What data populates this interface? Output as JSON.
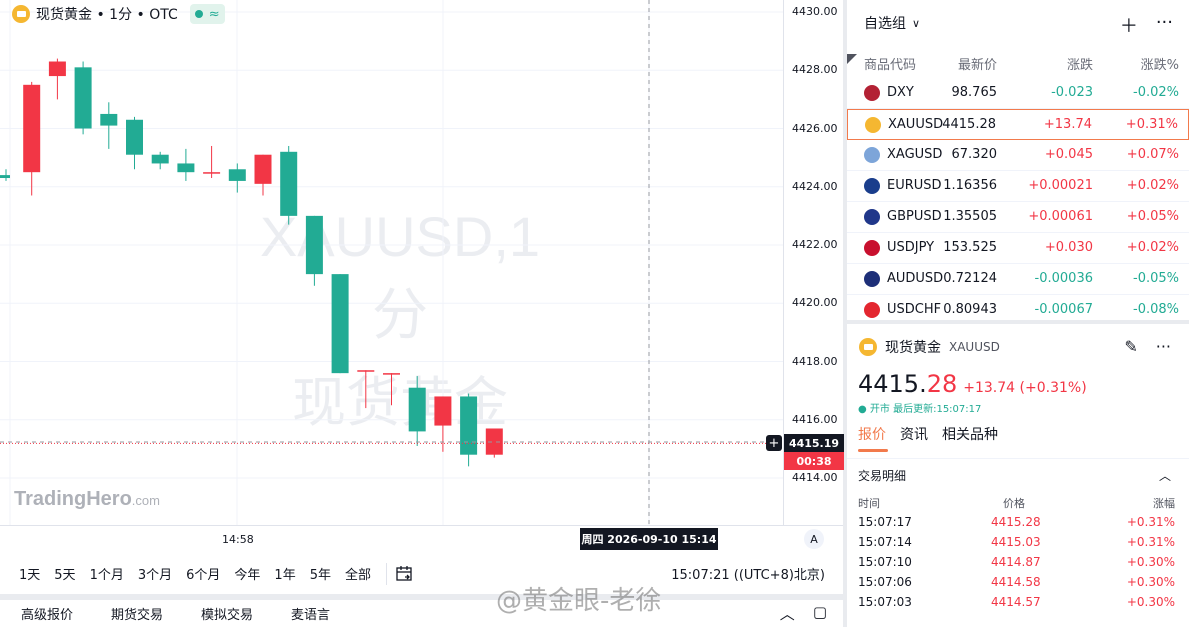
{
  "legend": {
    "title": "现货黄金 • 1分 • OTC",
    "status_icon": "≈"
  },
  "watermark": {
    "line1": "XAUUSD,1分",
    "line2": "现货黄金"
  },
  "logo": {
    "name": "TradingHero",
    "suffix": ".com"
  },
  "colors": {
    "up": "#f23645",
    "down": "#22ab94",
    "accent": "#f27a4c",
    "gold": "#f5b731"
  },
  "chart_data": {
    "type": "candlestick",
    "interval": "1分",
    "symbol": "XAUUSD",
    "y_ticks": [
      "4430.00",
      "4428.00",
      "4426.00",
      "4424.00",
      "4422.00",
      "4420.00",
      "4418.00",
      "4416.00",
      "4414.00"
    ],
    "ylim": [
      4413.5,
      4430.2
    ],
    "x_tick_label": "14:58",
    "candles": [
      {
        "o": 4424.4,
        "h": 4424.6,
        "l": 4424.2,
        "c": 4424.3
      },
      {
        "o": 4424.5,
        "h": 4427.6,
        "l": 4423.7,
        "c": 4427.5
      },
      {
        "o": 4427.8,
        "h": 4428.4,
        "l": 4427.0,
        "c": 4428.3
      },
      {
        "o": 4428.1,
        "h": 4428.3,
        "l": 4425.8,
        "c": 4426.0
      },
      {
        "o": 4426.5,
        "h": 4426.9,
        "l": 4425.3,
        "c": 4426.1
      },
      {
        "o": 4426.3,
        "h": 4426.4,
        "l": 4424.6,
        "c": 4425.1
      },
      {
        "o": 4425.1,
        "h": 4425.2,
        "l": 4424.6,
        "c": 4424.8
      },
      {
        "o": 4424.8,
        "h": 4425.3,
        "l": 4424.2,
        "c": 4424.5
      },
      {
        "o": 4424.5,
        "h": 4425.4,
        "l": 4424.3,
        "c": 4424.5
      },
      {
        "o": 4424.6,
        "h": 4424.8,
        "l": 4423.8,
        "c": 4424.2
      },
      {
        "o": 4424.1,
        "h": 4425.1,
        "l": 4423.7,
        "c": 4425.1
      },
      {
        "o": 4425.2,
        "h": 4425.4,
        "l": 4422.7,
        "c": 4423.0
      },
      {
        "o": 4423.0,
        "h": 4423.0,
        "l": 4420.6,
        "c": 4421.0
      },
      {
        "o": 4421.0,
        "h": 4421.0,
        "l": 4417.8,
        "c": 4417.6
      },
      {
        "o": 4417.7,
        "h": 4417.7,
        "l": 4416.4,
        "c": 4417.7
      },
      {
        "o": 4417.6,
        "h": 4417.5,
        "l": 4416.5,
        "c": 4417.6
      },
      {
        "o": 4417.1,
        "h": 4417.5,
        "l": 4415.1,
        "c": 4415.6
      },
      {
        "o": 4415.8,
        "h": 4416.7,
        "l": 4414.9,
        "c": 4416.8
      },
      {
        "o": 4416.8,
        "h": 4416.9,
        "l": 4414.4,
        "c": 4414.8
      },
      {
        "o": 4414.8,
        "h": 4415.6,
        "l": 4414.7,
        "c": 4415.7
      }
    ],
    "current_price": "4415.19",
    "countdown": "00:38",
    "crosshair_time": "周四 2026-09-10   15:14"
  },
  "axis": {
    "auto_label": "A"
  },
  "ranges": [
    "1天",
    "5天",
    "1个月",
    "3个月",
    "6个月",
    "今年",
    "1年",
    "5年",
    "全部"
  ],
  "clock": "15:07:21  ((UTC+8)北京)",
  "bottom_tabs": [
    "高级报价",
    "期货交易",
    "模拟交易",
    "麦语言"
  ],
  "watchlist": {
    "title": "自选组",
    "columns": [
      "商品代码",
      "最新价",
      "涨跌",
      "涨跌%"
    ],
    "rows": [
      {
        "symbol": "DXY",
        "last": "98.765",
        "change": "-0.023",
        "pct": "-0.02%",
        "dir": "dn",
        "icon_color": "#b32134"
      },
      {
        "symbol": "XAUUSD",
        "last": "4415.28",
        "change": "+13.74",
        "pct": "+0.31%",
        "dir": "up",
        "icon_color": "#f5b731",
        "selected": true
      },
      {
        "symbol": "XAGUSD",
        "last": "67.320",
        "change": "+0.045",
        "pct": "+0.07%",
        "dir": "up",
        "icon_color": "#7da5d9"
      },
      {
        "symbol": "EURUSD",
        "last": "1.16356",
        "change": "+0.00021",
        "pct": "+0.02%",
        "dir": "up",
        "icon_color": "#1a3e8c"
      },
      {
        "symbol": "GBPUSD",
        "last": "1.35505",
        "change": "+0.00061",
        "pct": "+0.05%",
        "dir": "up",
        "icon_color": "#20378a"
      },
      {
        "symbol": "USDJPY",
        "last": "153.525",
        "change": "+0.030",
        "pct": "+0.02%",
        "dir": "up",
        "icon_color": "#c8102e"
      },
      {
        "symbol": "AUDUSD",
        "last": "0.72124",
        "change": "-0.00036",
        "pct": "-0.05%",
        "dir": "dn",
        "icon_color": "#1d2f78"
      },
      {
        "symbol": "USDCHF",
        "last": "0.80943",
        "change": "-0.00067",
        "pct": "-0.08%",
        "dir": "dn",
        "icon_color": "#e3262f"
      }
    ]
  },
  "detail": {
    "name": "现货黄金",
    "symbol": "XAUUSD",
    "price_int": "4415.",
    "price_dec": "28",
    "change": "+13.74 (+0.31%)",
    "meta": "● 开市  最后更新:15:07:17",
    "tabs": [
      "报价",
      "资讯",
      "相关品种"
    ],
    "trades_title": "交易明细",
    "trade_columns": [
      "时间",
      "价格",
      "涨幅"
    ],
    "trades": [
      {
        "time": "15:07:17",
        "price": "4415.28",
        "pct": "+0.31%"
      },
      {
        "time": "15:07:14",
        "price": "4415.03",
        "pct": "+0.31%"
      },
      {
        "time": "15:07:10",
        "price": "4414.87",
        "pct": "+0.30%"
      },
      {
        "time": "15:07:06",
        "price": "4414.58",
        "pct": "+0.30%"
      },
      {
        "time": "15:07:03",
        "price": "4414.57",
        "pct": "+0.30%"
      }
    ]
  },
  "overlay_watermark": "@黄金眼-老徐"
}
